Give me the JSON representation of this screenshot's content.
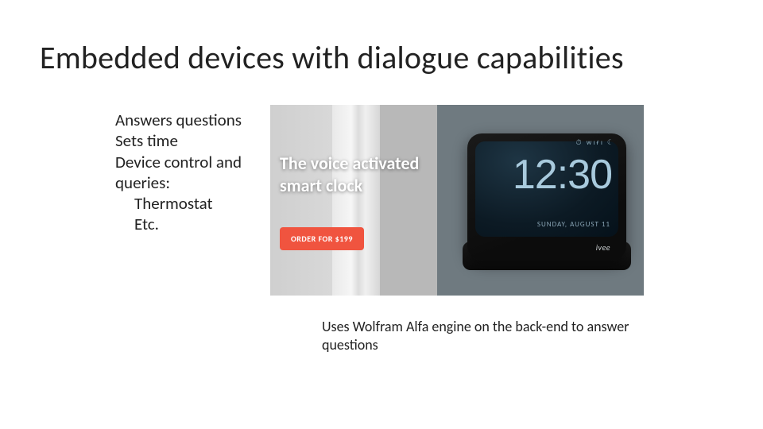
{
  "title": "Embedded devices with dialogue capabilities",
  "bullets": {
    "l1": "Answers questions",
    "l2": "Sets time",
    "l3": "Device control and",
    "l4": "queries:",
    "l5": "Thermostat",
    "l6": "Etc."
  },
  "promo": {
    "headline": "The voice activated smart clock",
    "cta": "ORDER FOR $199"
  },
  "device": {
    "icons": "⏱ ᴡɪғɪ ☾",
    "time": "12:30",
    "date": "SUNDAY, AUGUST 11",
    "brand": "ivee"
  },
  "caption": "Uses Wolfram Alfa engine on the back-end to answer questions"
}
